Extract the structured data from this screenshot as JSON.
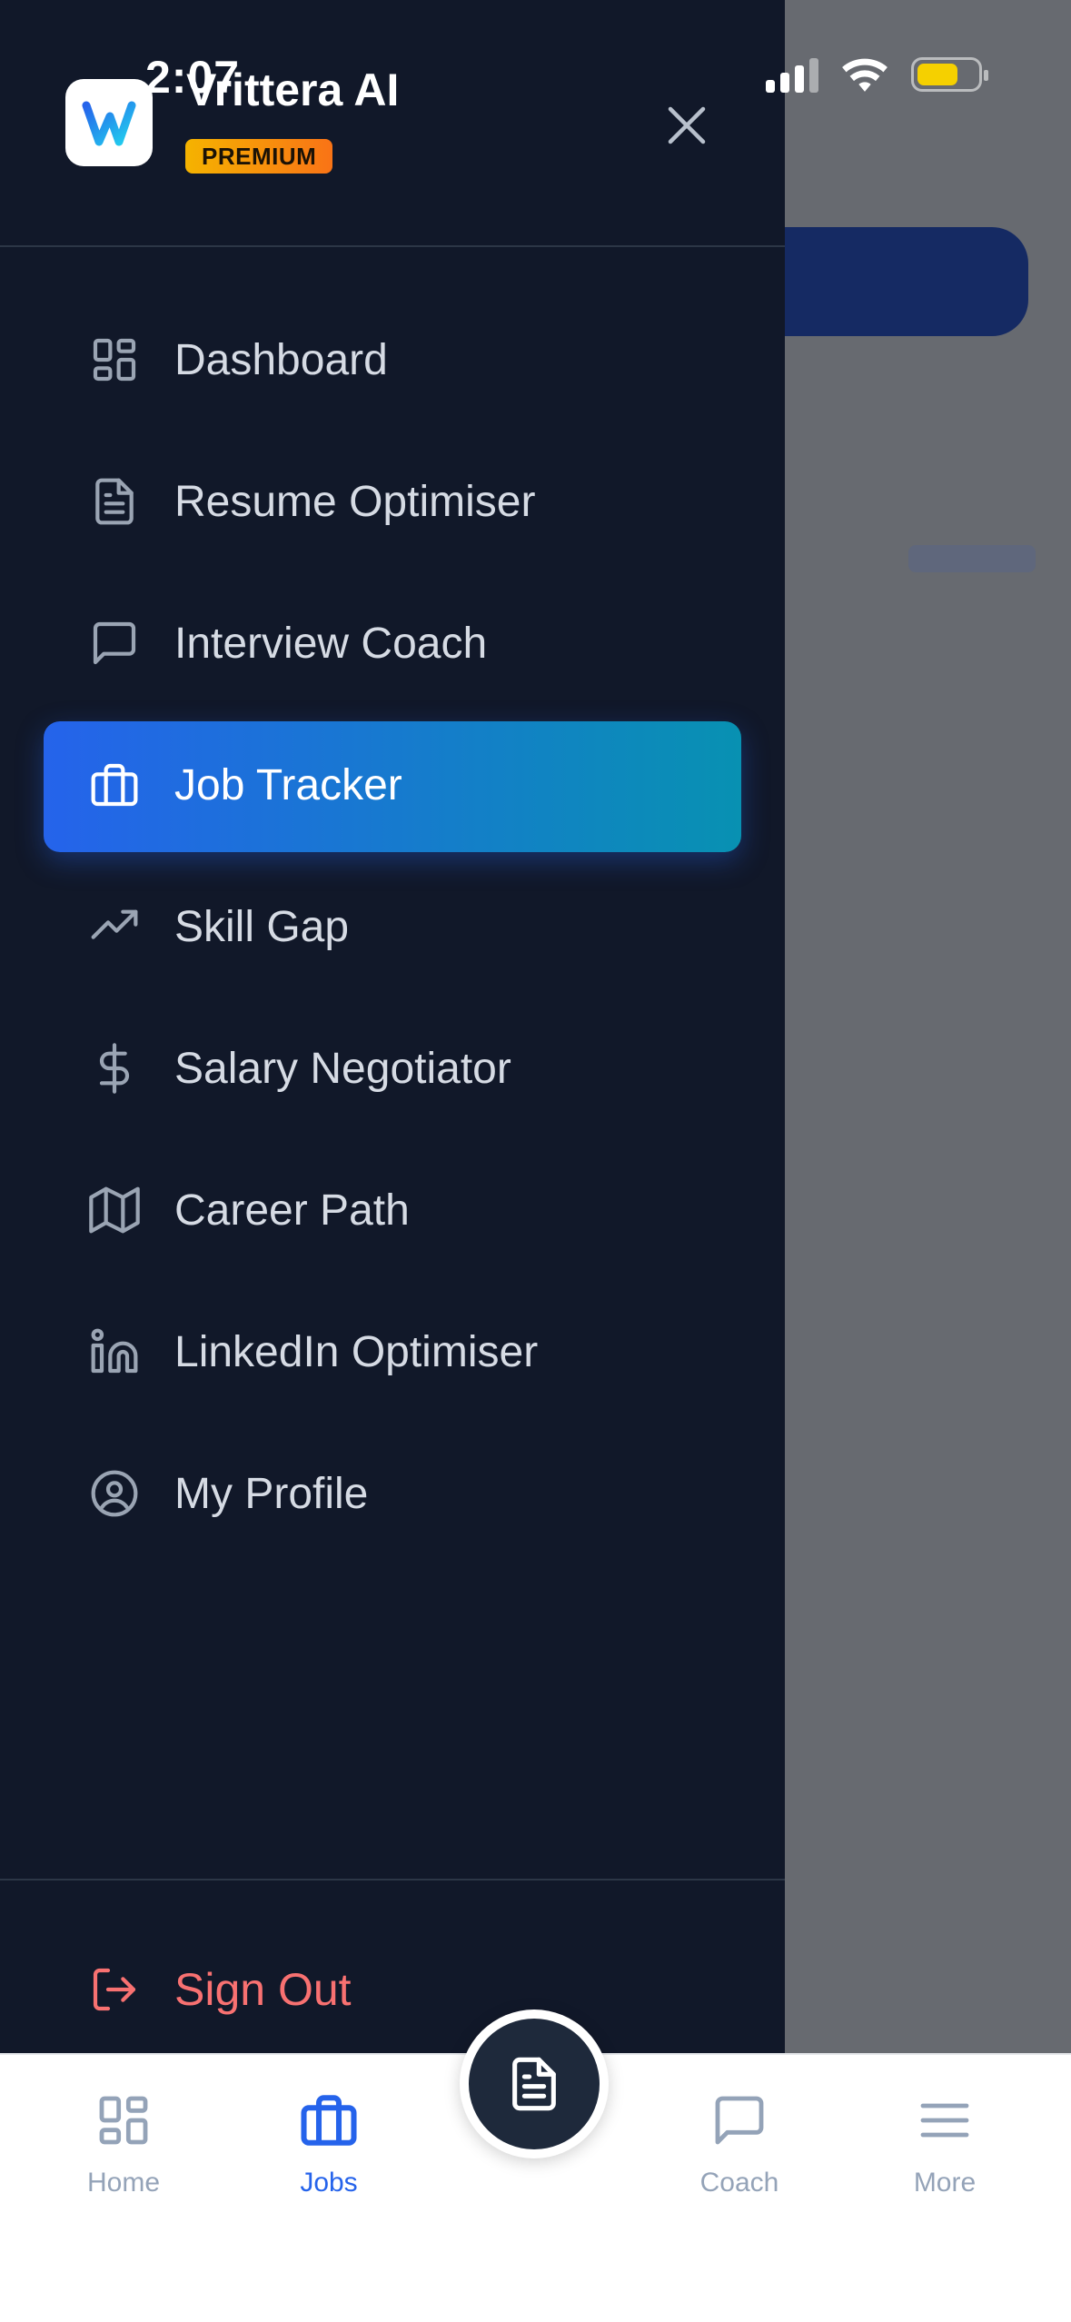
{
  "status_bar": {
    "time": "2:07"
  },
  "app": {
    "name": "Vrittera AI",
    "badge": "PREMIUM"
  },
  "drawer": {
    "items": [
      {
        "label": "Dashboard",
        "icon": "dashboard-icon"
      },
      {
        "label": "Resume Optimiser",
        "icon": "document-icon"
      },
      {
        "label": "Interview Coach",
        "icon": "chat-bubble-icon"
      },
      {
        "label": "Job Tracker",
        "icon": "briefcase-icon",
        "active": true
      },
      {
        "label": "Skill Gap",
        "icon": "trending-up-icon"
      },
      {
        "label": "Salary Negotiator",
        "icon": "dollar-icon"
      },
      {
        "label": "Career Path",
        "icon": "map-icon"
      },
      {
        "label": "LinkedIn Optimiser",
        "icon": "linkedin-icon"
      },
      {
        "label": "My Profile",
        "icon": "user-circle-icon"
      }
    ],
    "sign_out": "Sign Out"
  },
  "tabbar": {
    "tabs": [
      {
        "label": "Home",
        "icon": "home-grid-icon"
      },
      {
        "label": "Jobs",
        "icon": "briefcase-icon",
        "active": true
      },
      {
        "label": "Coach",
        "icon": "chat-bubble-icon"
      },
      {
        "label": "More",
        "icon": "menu-icon"
      }
    ],
    "center_action_icon": "document-icon"
  },
  "colors": {
    "drawer_bg": "#111829",
    "active_gradient_start": "#2563eb",
    "active_gradient_end": "#0891b2",
    "sign_out": "#f87171",
    "tab_active": "#2563eb",
    "premium_badge_start": "#f5b300",
    "premium_badge_end": "#f97316"
  }
}
